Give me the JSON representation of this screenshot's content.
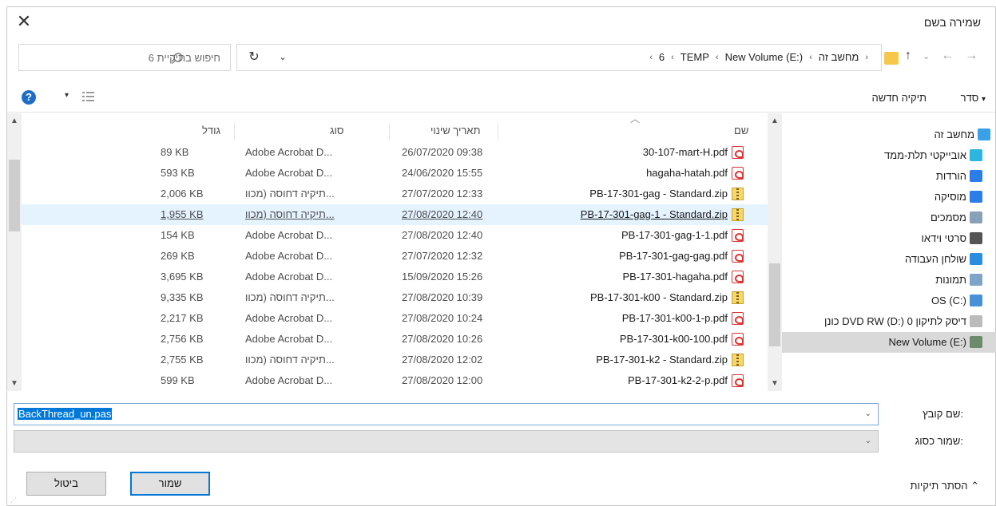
{
  "window": {
    "title": "שמירה בשם",
    "close_glyph": "✕"
  },
  "address": {
    "search_placeholder": "חיפוש בתיקיית 6",
    "crumbs": [
      "מחשב זה",
      "New Volume (E:)",
      "TEMP",
      "6"
    ],
    "crumb_sep": "›",
    "crumb_lead": "‹",
    "refresh_glyph": "↻",
    "dropdown_glyph": "⌄",
    "nav_back": "←",
    "nav_forward": "→",
    "nav_recent": "⌄",
    "nav_up": "↑"
  },
  "toolbar": {
    "organize": "סדר",
    "organize_caret": "▾",
    "new_folder": "תיקיה חדשה",
    "help_glyph": "?",
    "view_caret": "▾"
  },
  "columns": {
    "name": "שם",
    "date": "תאריך שינוי",
    "type": "סוג",
    "size": "גודל"
  },
  "files": [
    {
      "name": "30-107-mart-H.pdf",
      "date": "26/07/2020 09:38",
      "type": "Adobe Acrobat D...",
      "size": "89 KB",
      "icon": "pdf"
    },
    {
      "name": "hagaha-hatah.pdf",
      "date": "24/06/2020 15:55",
      "type": "Adobe Acrobat D...",
      "size": "593 KB",
      "icon": "pdf"
    },
    {
      "name": "PB-17-301-gag - Standard.zip",
      "date": "27/07/2020 12:33",
      "type": "תיקיה דחוסה (מכוו...",
      "size": "2,006 KB",
      "icon": "zip"
    },
    {
      "name": "PB-17-301-gag-1 - Standard.zip",
      "date": "27/08/2020 12:40",
      "type": "תיקיה דחוסה (מכוו...",
      "size": "1,955 KB",
      "icon": "zip",
      "selected": true
    },
    {
      "name": "PB-17-301-gag-1-1.pdf",
      "date": "27/08/2020 12:40",
      "type": "Adobe Acrobat D...",
      "size": "154 KB",
      "icon": "pdf"
    },
    {
      "name": "PB-17-301-gag-gag.pdf",
      "date": "27/07/2020 12:32",
      "type": "Adobe Acrobat D...",
      "size": "269 KB",
      "icon": "pdf"
    },
    {
      "name": "PB-17-301-hagaha.pdf",
      "date": "15/09/2020 15:26",
      "type": "Adobe Acrobat D...",
      "size": "3,695 KB",
      "icon": "pdf"
    },
    {
      "name": "PB-17-301-k00 - Standard.zip",
      "date": "27/08/2020 10:39",
      "type": "תיקיה דחוסה (מכוו...",
      "size": "9,335 KB",
      "icon": "zip"
    },
    {
      "name": "PB-17-301-k00-1-p.pdf",
      "date": "27/08/2020 10:24",
      "type": "Adobe Acrobat D...",
      "size": "2,217 KB",
      "icon": "pdf"
    },
    {
      "name": "PB-17-301-k00-100.pdf",
      "date": "27/08/2020 10:26",
      "type": "Adobe Acrobat D...",
      "size": "2,756 KB",
      "icon": "pdf"
    },
    {
      "name": "PB-17-301-k2 - Standard.zip",
      "date": "27/08/2020 12:02",
      "type": "תיקיה דחוסה (מכוו...",
      "size": "2,755 KB",
      "icon": "zip"
    },
    {
      "name": "PB-17-301-k2-2-p.pdf",
      "date": "27/08/2020 12:00",
      "type": "Adobe Acrobat D...",
      "size": "599 KB",
      "icon": "pdf"
    }
  ],
  "nav": [
    {
      "label": "מחשב זה",
      "icon": "computer-icon",
      "level": 1,
      "color": "#3aa0e8"
    },
    {
      "label": "אובייקטי תלת-ממד",
      "icon": "cube-3d-icon",
      "level": 2,
      "color": "#2bb5e0"
    },
    {
      "label": "הורדות",
      "icon": "download-icon",
      "level": 2,
      "color": "#2b7de9"
    },
    {
      "label": "מוסיקה",
      "icon": "music-icon",
      "level": 2,
      "color": "#2b7de9"
    },
    {
      "label": "מסמכים",
      "icon": "documents-icon",
      "level": 2,
      "color": "#8aa0b8"
    },
    {
      "label": "סרטי וידאו",
      "icon": "video-icon",
      "level": 2,
      "color": "#555555"
    },
    {
      "label": "שולחן העבודה",
      "icon": "desktop-icon",
      "level": 2,
      "color": "#2b8de0"
    },
    {
      "label": "תמונות",
      "icon": "pictures-icon",
      "level": 2,
      "color": "#7fa4c9"
    },
    {
      "label": "OS (C:)",
      "icon": "drive-c-icon",
      "level": 2,
      "color": "#4a90d9"
    },
    {
      "label": "כונן DVD RW (D:) דיסק לתיקון 0",
      "icon": "dvd-icon",
      "level": 2,
      "color": "#bbbbbb"
    },
    {
      "label": "New Volume (E:)",
      "icon": "drive-e-icon",
      "level": 2,
      "color": "#6c8a6c",
      "selected": true
    }
  ],
  "form": {
    "filename_label": "שם קובץ:",
    "filename_value": "BackThread_un.pas",
    "filetype_label": "שמור כסוג:",
    "filetype_value": "",
    "dropdown_glyph": "⌄"
  },
  "footer": {
    "hide_folders": "הסתר תיקיות",
    "hide_caret": "⌃",
    "save": "שמור",
    "cancel": "ביטול"
  }
}
